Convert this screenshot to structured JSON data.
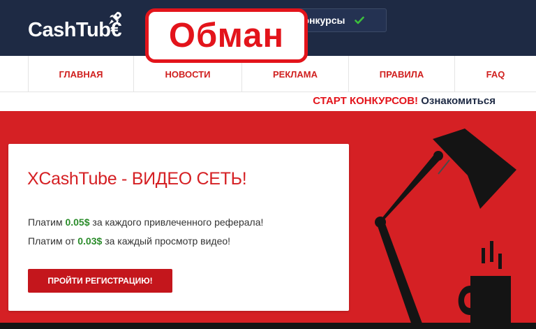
{
  "header": {
    "logo_text": "CashTub€",
    "contests_label": "Конкурсы"
  },
  "stamp": {
    "text": "Обман"
  },
  "nav": {
    "items": [
      {
        "label": "ГЛАВНАЯ"
      },
      {
        "label": "НОВОСТИ"
      },
      {
        "label": "РЕКЛАМА"
      },
      {
        "label": "ПРАВИЛА"
      },
      {
        "label": "FAQ"
      }
    ]
  },
  "announcement": {
    "highlight": "СТАРТ КОНКУРСОВ!",
    "link": "Ознакомиться"
  },
  "hero": {
    "title": "XCashTube - ВИДЕО СЕТЬ!",
    "line1": {
      "prefix": "Платим",
      "amount": "0.05$",
      "suffix": "за каждого привлеченного реферала!"
    },
    "line2": {
      "prefix": "Платим от",
      "amount": "0.03$",
      "suffix": "за каждый просмотр видео!"
    },
    "register_label": "ПРОЙТИ РЕГИСТРАЦИЮ!"
  },
  "colors": {
    "header_bg": "#1e2a44",
    "brand_red": "#d52024",
    "stamp_red": "#e3141b",
    "amount_green": "#2a8c2a",
    "check_green": "#3cbf3c"
  },
  "icons": {
    "logo": "rocket-icon",
    "contests": "check-icon",
    "illustration": "desk-lamp-and-mug"
  }
}
